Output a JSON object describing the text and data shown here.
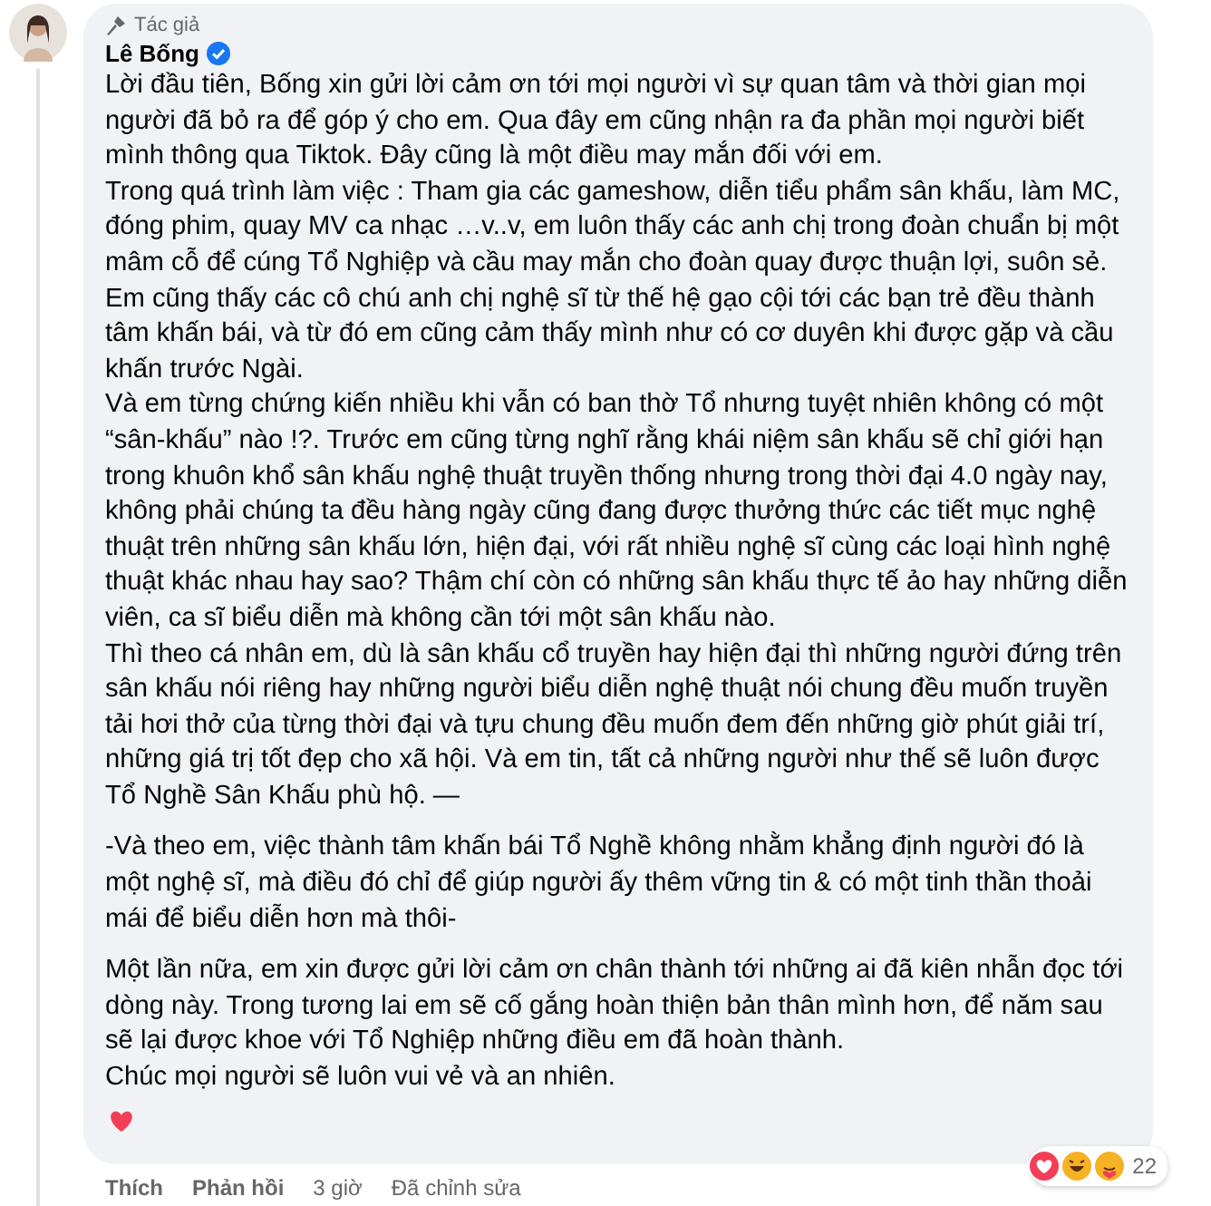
{
  "comment": {
    "badge": "Tác giả",
    "author": "Lê Bống",
    "sections": [
      [
        "Lời đầu tiên, Bống xin gửi lời cảm ơn tới mọi người vì sự quan tâm và thời gian mọi người đã bỏ ra để góp ý cho em. Qua đây em cũng nhận ra đa phần mọi người biết mình thông qua Tiktok. Đây cũng là một điều may mắn đối với em.",
        "Trong quá trình làm việc : Tham gia các gameshow, diễn tiểu phẩm sân khấu, làm MC, đóng phim, quay MV ca nhạc …v..v, em luôn thấy các anh chị trong đoàn chuẩn bị một mâm cỗ để cúng Tổ Nghiệp và cầu may mắn cho đoàn quay được thuận lợi, suôn sẻ. Em cũng thấy các cô chú anh chị nghệ sĩ từ thế hệ gạo cội tới các bạn trẻ đều thành tâm khấn bái, và từ đó em cũng cảm thấy mình như có cơ duyên khi được gặp và cầu khấn trước Ngài.",
        "Và em từng chứng kiến nhiều khi vẫn có ban thờ Tổ nhưng tuyệt nhiên không có một “sân-khấu” nào !?. Trước em cũng từng nghĩ rằng khái niệm sân khấu sẽ chỉ giới hạn trong khuôn khổ sân khấu nghệ thuật truyền thống nhưng trong thời đại 4.0 ngày nay, không phải chúng ta đều hàng ngày cũng đang được thưởng thức các tiết mục nghệ thuật trên những sân khấu lớn, hiện đại, với rất nhiều nghệ sĩ cùng các loại hình nghệ thuật khác nhau hay sao? Thậm chí còn có những sân khấu thực tế ảo hay những diễn viên, ca sĩ biểu diễn mà không cần tới một sân khấu nào.",
        "Thì theo cá nhân em, dù là sân khấu cổ truyền hay hiện đại thì những người đứng trên sân khấu nói riêng hay những người biểu diễn nghệ thuật nói chung đều muốn truyền tải hơi thở của từng thời đại và tựu chung đều muốn đem đến những giờ phút giải trí, những giá trị tốt đẹp cho xã hội. Và em tin, tất cả những người như thế sẽ luôn được Tổ Nghề Sân Khấu phù hộ. —"
      ],
      [
        "-Và theo em, việc thành tâm khấn bái Tổ Nghề không nhằm khẳng định người đó là một nghệ sĩ, mà điều đó chỉ để giúp người ấy thêm vững tin & có một tinh thần thoải mái để biểu diễn hơn mà thôi-"
      ],
      [
        "Một lần nữa, em xin được gửi lời cảm ơn chân thành tới những ai đã kiên nhẫn đọc tới dòng này. Trong tương lai em sẽ cố gắng hoàn thiện bản thân mình hơn, để năm sau sẽ lại được khoe với Tổ Nghiệp những điều em đã hoàn thành.",
        "Chúc mọi người sẽ luôn vui vẻ và an nhiên."
      ]
    ],
    "reaction_count": "22",
    "actions": [
      "Thích",
      "Phản hồi"
    ],
    "time": "3 giờ",
    "edited": "Đã chỉnh sửa"
  }
}
